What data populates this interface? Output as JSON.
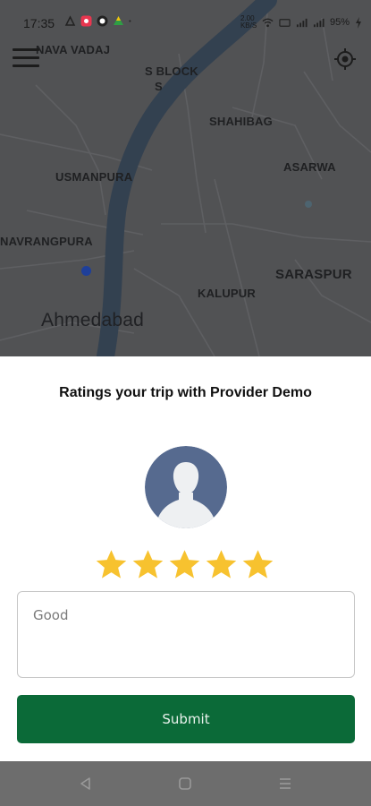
{
  "status_bar": {
    "time": "17:35",
    "network_speed": "2.00 KB/S",
    "battery": "95%"
  },
  "map": {
    "labels": {
      "nava_vadaj": "NAVA VADAJ",
      "s_block": "S BLOCK",
      "s_block_2": "S",
      "shahibag": "SHAHIBAG",
      "usmanpura": "USMANPURA",
      "asarwa": "ASARWA",
      "navrangpura": "NAVRANGPURA",
      "saraspur": "SARASPUR",
      "kalupur": "KALUPUR",
      "ahmedabad": "Ahmedabad"
    },
    "icons": {
      "menu": "hamburger-menu-icon",
      "locate": "gps-target-icon"
    }
  },
  "rating": {
    "title": "Ratings your trip with Provider Demo",
    "stars_filled": 5,
    "stars_total": 5,
    "comment_placeholder": "Good",
    "submit_label": "Submit"
  },
  "colors": {
    "submit": "#0b6a38",
    "star": "#f7c22f",
    "avatar_bg": "#566a8f",
    "map": "#5d5e60"
  }
}
